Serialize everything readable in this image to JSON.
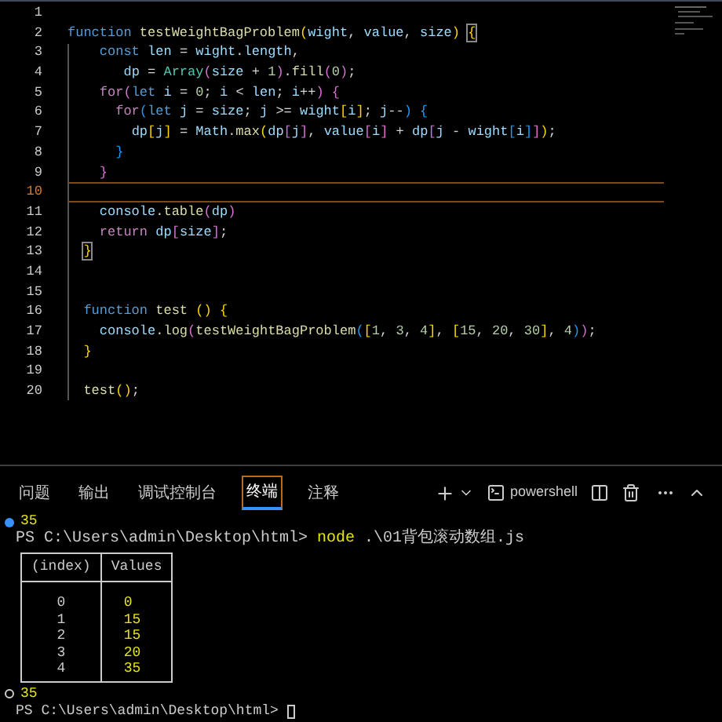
{
  "editor": {
    "lines": [
      {
        "number": "1",
        "current": false
      },
      {
        "number": "2",
        "current": false,
        "tokens": [
          {
            "text": "function ",
            "kind": "kw"
          },
          {
            "text": "testWeightBagProblem",
            "kind": "fn"
          },
          {
            "text": "(",
            "kind": "b1"
          },
          {
            "text": "wight",
            "kind": "var"
          },
          {
            "text": ", ",
            "kind": "pl"
          },
          {
            "text": "value",
            "kind": "var"
          },
          {
            "text": ", ",
            "kind": "pl"
          },
          {
            "text": "size",
            "kind": "var"
          },
          {
            "text": ") ",
            "kind": "b1"
          },
          {
            "text": "{",
            "kind": "b1",
            "match": true
          }
        ]
      },
      {
        "number": "3",
        "current": false,
        "tokens": [
          {
            "text": "    const ",
            "kind": "kw"
          },
          {
            "text": "len",
            "kind": "var"
          },
          {
            "text": " = ",
            "kind": "pl"
          },
          {
            "text": "wight",
            "kind": "var"
          },
          {
            "text": ".",
            "kind": "pl"
          },
          {
            "text": "length",
            "kind": "var"
          },
          {
            "text": ",",
            "kind": "pl"
          }
        ]
      },
      {
        "number": "4",
        "current": false,
        "tokens": [
          {
            "text": "       dp",
            "kind": "var"
          },
          {
            "text": " = ",
            "kind": "pl"
          },
          {
            "text": "Array",
            "kind": "cls"
          },
          {
            "text": "(",
            "kind": "b2"
          },
          {
            "text": "size",
            "kind": "var"
          },
          {
            "text": " + ",
            "kind": "pl"
          },
          {
            "text": "1",
            "kind": "num"
          },
          {
            "text": ")",
            "kind": "b2"
          },
          {
            "text": ".",
            "kind": "pl"
          },
          {
            "text": "fill",
            "kind": "fn"
          },
          {
            "text": "(",
            "kind": "b2"
          },
          {
            "text": "0",
            "kind": "num"
          },
          {
            "text": ")",
            "kind": "b2"
          },
          {
            "text": ";",
            "kind": "pl"
          }
        ]
      },
      {
        "number": "5",
        "current": false,
        "tokens": [
          {
            "text": "    for",
            "kind": "ctl"
          },
          {
            "text": "(",
            "kind": "b2"
          },
          {
            "text": "let ",
            "kind": "kw"
          },
          {
            "text": "i",
            "kind": "var"
          },
          {
            "text": " = ",
            "kind": "pl"
          },
          {
            "text": "0",
            "kind": "num"
          },
          {
            "text": "; ",
            "kind": "pl"
          },
          {
            "text": "i",
            "kind": "var"
          },
          {
            "text": " < ",
            "kind": "pl"
          },
          {
            "text": "len",
            "kind": "var"
          },
          {
            "text": "; ",
            "kind": "pl"
          },
          {
            "text": "i",
            "kind": "var"
          },
          {
            "text": "++",
            "kind": "pl"
          },
          {
            "text": ") {",
            "kind": "b2"
          }
        ]
      },
      {
        "number": "6",
        "current": false,
        "tokens": [
          {
            "text": "      for",
            "kind": "ctl"
          },
          {
            "text": "(",
            "kind": "b3"
          },
          {
            "text": "let ",
            "kind": "kw"
          },
          {
            "text": "j",
            "kind": "var"
          },
          {
            "text": " = ",
            "kind": "pl"
          },
          {
            "text": "size",
            "kind": "var"
          },
          {
            "text": "; ",
            "kind": "pl"
          },
          {
            "text": "j",
            "kind": "var"
          },
          {
            "text": " >= ",
            "kind": "pl"
          },
          {
            "text": "wight",
            "kind": "var"
          },
          {
            "text": "[",
            "kind": "b1"
          },
          {
            "text": "i",
            "kind": "var"
          },
          {
            "text": "]",
            "kind": "b1"
          },
          {
            "text": "; ",
            "kind": "pl"
          },
          {
            "text": "j",
            "kind": "var"
          },
          {
            "text": "--",
            "kind": "pl"
          },
          {
            "text": ") {",
            "kind": "b3"
          }
        ]
      },
      {
        "number": "7",
        "current": false,
        "tokens": [
          {
            "text": "        dp",
            "kind": "var"
          },
          {
            "text": "[",
            "kind": "b1"
          },
          {
            "text": "j",
            "kind": "var"
          },
          {
            "text": "]",
            "kind": "b1"
          },
          {
            "text": " = ",
            "kind": "pl"
          },
          {
            "text": "Math",
            "kind": "var"
          },
          {
            "text": ".",
            "kind": "pl"
          },
          {
            "text": "max",
            "kind": "fn"
          },
          {
            "text": "(",
            "kind": "b1"
          },
          {
            "text": "dp",
            "kind": "var"
          },
          {
            "text": "[",
            "kind": "b2"
          },
          {
            "text": "j",
            "kind": "var"
          },
          {
            "text": "]",
            "kind": "b2"
          },
          {
            "text": ", ",
            "kind": "pl"
          },
          {
            "text": "value",
            "kind": "var"
          },
          {
            "text": "[",
            "kind": "b2"
          },
          {
            "text": "i",
            "kind": "var"
          },
          {
            "text": "]",
            "kind": "b2"
          },
          {
            "text": " + ",
            "kind": "pl"
          },
          {
            "text": "dp",
            "kind": "var"
          },
          {
            "text": "[",
            "kind": "b2"
          },
          {
            "text": "j",
            "kind": "var"
          },
          {
            "text": " - ",
            "kind": "pl"
          },
          {
            "text": "wight",
            "kind": "var"
          },
          {
            "text": "[",
            "kind": "b3"
          },
          {
            "text": "i",
            "kind": "var"
          },
          {
            "text": "]",
            "kind": "b3"
          },
          {
            "text": "]",
            "kind": "b2"
          },
          {
            "text": ")",
            "kind": "b1"
          },
          {
            "text": ";",
            "kind": "pl"
          }
        ]
      },
      {
        "number": "8",
        "current": false,
        "tokens": [
          {
            "text": "      }",
            "kind": "b3"
          }
        ]
      },
      {
        "number": "9",
        "current": false,
        "tokens": [
          {
            "text": "    }",
            "kind": "b2"
          }
        ]
      },
      {
        "number": "10",
        "current": true
      },
      {
        "number": "11",
        "current": false,
        "tokens": [
          {
            "text": "    console",
            "kind": "var"
          },
          {
            "text": ".",
            "kind": "pl"
          },
          {
            "text": "table",
            "kind": "fn"
          },
          {
            "text": "(",
            "kind": "b2"
          },
          {
            "text": "dp",
            "kind": "var"
          },
          {
            "text": ")",
            "kind": "b2"
          }
        ]
      },
      {
        "number": "12",
        "current": false,
        "tokens": [
          {
            "text": "    return ",
            "kind": "ctl"
          },
          {
            "text": "dp",
            "kind": "var"
          },
          {
            "text": "[",
            "kind": "b2"
          },
          {
            "text": "size",
            "kind": "var"
          },
          {
            "text": "]",
            "kind": "b2"
          },
          {
            "text": ";",
            "kind": "pl"
          }
        ]
      },
      {
        "number": "13",
        "current": false,
        "tokens": [
          {
            "text": "  }",
            "kind": "b1",
            "match": true
          }
        ]
      },
      {
        "number": "14",
        "current": false
      },
      {
        "number": "15",
        "current": false
      },
      {
        "number": "16",
        "current": false,
        "tokens": [
          {
            "text": "  function ",
            "kind": "kw"
          },
          {
            "text": "test ",
            "kind": "fn"
          },
          {
            "text": "() {",
            "kind": "b1"
          }
        ]
      },
      {
        "number": "17",
        "current": false,
        "tokens": [
          {
            "text": "    console",
            "kind": "var"
          },
          {
            "text": ".",
            "kind": "pl"
          },
          {
            "text": "log",
            "kind": "fn"
          },
          {
            "text": "(",
            "kind": "b2"
          },
          {
            "text": "testWeightBagProblem",
            "kind": "fn"
          },
          {
            "text": "(",
            "kind": "b3"
          },
          {
            "text": "[",
            "kind": "b1"
          },
          {
            "text": "1",
            "kind": "num"
          },
          {
            "text": ", ",
            "kind": "pl"
          },
          {
            "text": "3",
            "kind": "num"
          },
          {
            "text": ", ",
            "kind": "pl"
          },
          {
            "text": "4",
            "kind": "num"
          },
          {
            "text": "]",
            "kind": "b1"
          },
          {
            "text": ", ",
            "kind": "pl"
          },
          {
            "text": "[",
            "kind": "b1"
          },
          {
            "text": "15",
            "kind": "num"
          },
          {
            "text": ", ",
            "kind": "pl"
          },
          {
            "text": "20",
            "kind": "num"
          },
          {
            "text": ", ",
            "kind": "pl"
          },
          {
            "text": "30",
            "kind": "num"
          },
          {
            "text": "]",
            "kind": "b1"
          },
          {
            "text": ", ",
            "kind": "pl"
          },
          {
            "text": "4",
            "kind": "num"
          },
          {
            "text": ")",
            "kind": "b3"
          },
          {
            "text": ")",
            "kind": "b2"
          },
          {
            "text": ";",
            "kind": "pl"
          }
        ]
      },
      {
        "number": "18",
        "current": false,
        "tokens": [
          {
            "text": "  }",
            "kind": "b1"
          }
        ]
      },
      {
        "number": "19",
        "current": false
      },
      {
        "number": "20",
        "current": false,
        "tokens": [
          {
            "text": "  test",
            "kind": "fn"
          },
          {
            "text": "()",
            "kind": "b1"
          },
          {
            "text": ";",
            "kind": "pl"
          }
        ]
      }
    ]
  },
  "panel": {
    "tabs": [
      {
        "label": "问题",
        "selected": false
      },
      {
        "label": "输出",
        "selected": false
      },
      {
        "label": "调试控制台",
        "selected": false
      },
      {
        "label": "终端",
        "selected": true
      },
      {
        "label": "注释",
        "selected": false
      }
    ],
    "shell": "powershell"
  },
  "terminal": {
    "result_1": {
      "success": true,
      "text": "35"
    },
    "prompt_1": {
      "path": "PS C:\\Users\\admin\\Desktop\\html> ",
      "command": "node",
      "args": " .\\01背包滚动数组.js"
    },
    "table": {
      "columns": [
        "(index)",
        "Values"
      ],
      "rows": [
        [
          "0",
          "0"
        ],
        [
          "1",
          "15"
        ],
        [
          "2",
          "15"
        ],
        [
          "3",
          "20"
        ],
        [
          "4",
          "35"
        ]
      ]
    },
    "result_2": {
      "success": false,
      "text": "35"
    },
    "prompt_2": {
      "path": "PS C:\\Users\\admin\\Desktop\\html> "
    }
  }
}
